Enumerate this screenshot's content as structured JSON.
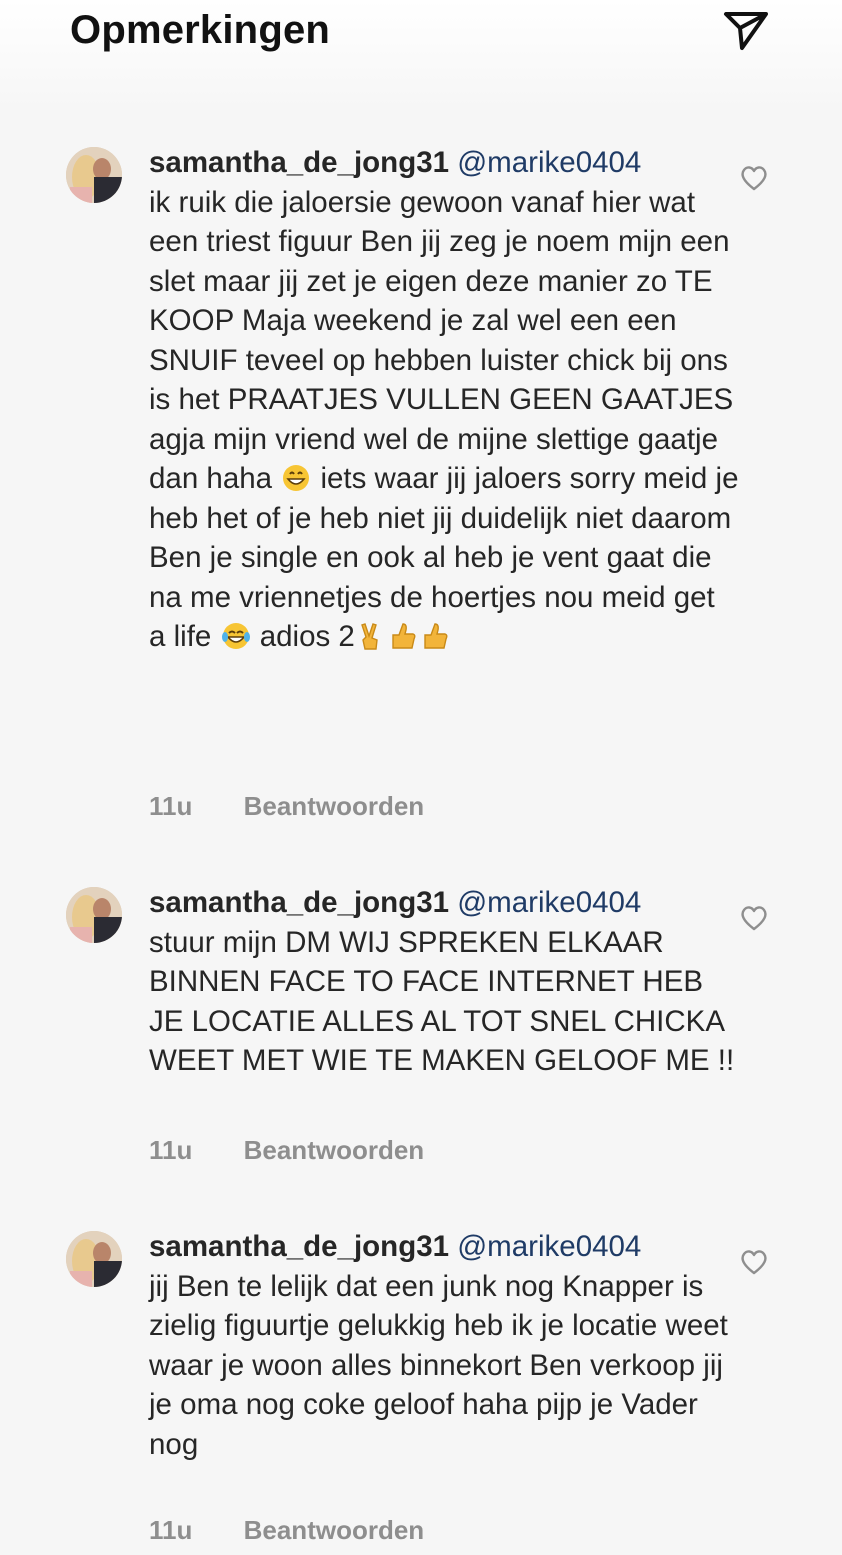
{
  "header": {
    "title": "Opmerkingen"
  },
  "comments": [
    {
      "username": "samantha_de_jong31",
      "mention": "@marike0404",
      "text_part1": "ik ruik die jaloersie gewoon vanaf hier wat een triest figuur Ben jij zeg je noem mijn een slet maar jij zet je eigen deze manier zo TE KOOP Maja weekend je zal wel een een SNUIF teveel op hebben luister chick bij ons is het PRAATJES VULLEN GEEN GAATJES agja mijn vriend wel de mijne slettige gaatje dan haha ",
      "emoji_1": "grinning-face-emoji",
      "text_part2": " iets waar jij jaloers sorry meid je heb het of je heb niet jij duidelijk niet daarom Ben je single en ook al heb je vent gaat die na me vriennetjes de hoertjes nou meid get a life ",
      "emoji_2": "tears-of-joy-emoji",
      "text_part3": " adios 2",
      "emoji_3": "victory-hand-emoji",
      "emoji_4": "thumbs-up-emoji",
      "emoji_5": "thumbs-up-emoji",
      "time": "11u",
      "reply_label": "Beantwoorden"
    },
    {
      "username": "samantha_de_jong31",
      "mention": "@marike0404",
      "text": "stuur mijn DM WIJ SPREKEN ELKAAR BINNEN FACE TO FACE INTERNET HEB JE LOCATIE ALLES AL TOT SNEL CHICKA WEET MET WIE TE MAKEN GELOOF ME !!",
      "time": "11u",
      "reply_label": "Beantwoorden"
    },
    {
      "username": "samantha_de_jong31",
      "mention": "@marike0404",
      "text": "jij Ben te lelijk dat een junk nog Knapper is zielig figuurtje gelukkig heb ik je locatie weet waar je woon alles binnekort Ben verkoop jij je oma nog coke geloof haha pijp je Vader nog",
      "time": "11u",
      "reply_label": "Beantwoorden"
    }
  ],
  "icons": {
    "share": "paper-plane-icon",
    "like": "heart-icon",
    "avatar": "profile-photo"
  },
  "colors": {
    "text": "#262626",
    "mention": "#1f3b66",
    "meta": "#8e8e8e",
    "background": "#f6f6f6"
  }
}
